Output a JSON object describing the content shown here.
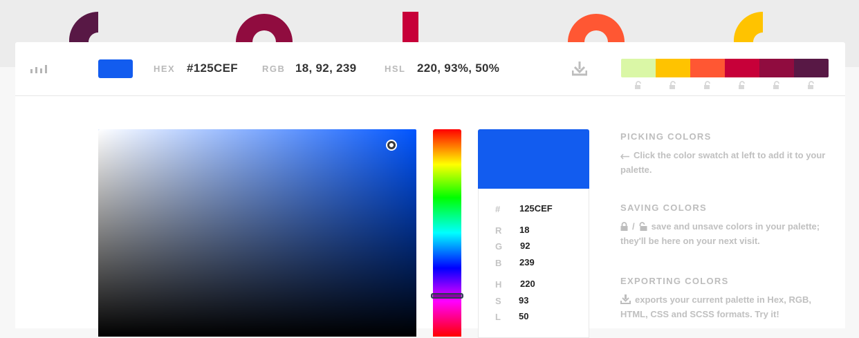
{
  "colors": {
    "current": "#125CEF",
    "palette": [
      "#DAF7A6",
      "#FFC300",
      "#FF5733",
      "#C70039",
      "#900C3F",
      "#581845"
    ]
  },
  "toolbar": {
    "hex_label": "HEX",
    "hex_value": "#125CEF",
    "rgb_label": "RGB",
    "rgb_value": "18, 92, 239",
    "hsl_label": "HSL",
    "hsl_value": "220, 93%, 50%",
    "icons": {
      "left": "bar-chart-icon",
      "download": "download-icon",
      "lock": "unlocked-icon"
    }
  },
  "picker": {
    "hue_degrees": 220,
    "saturation": 0.93,
    "value": 0.94
  },
  "details": {
    "hash_label": "#",
    "hash_value": "125CEF",
    "r_label": "R",
    "r_value": "18",
    "g_label": "G",
    "g_value": "92",
    "b_label": "B",
    "b_value": "239",
    "h_label": "H",
    "h_value": "220",
    "s_label": "S",
    "s_value": "93",
    "l_label": "L",
    "l_value": "50"
  },
  "help": {
    "picking_title": "PICKING COLORS",
    "picking_text": "Click the color swatch at left to add it to your palette.",
    "saving_title": "SAVING COLORS",
    "saving_sep": "/",
    "saving_text": "save and unsave colors in your palette; they'll be here on your next visit.",
    "exporting_title": "EXPORTING COLORS",
    "exporting_text": "exports your current palette in Hex, RGB, HTML, CSS and SCSS formats. Try it!"
  }
}
